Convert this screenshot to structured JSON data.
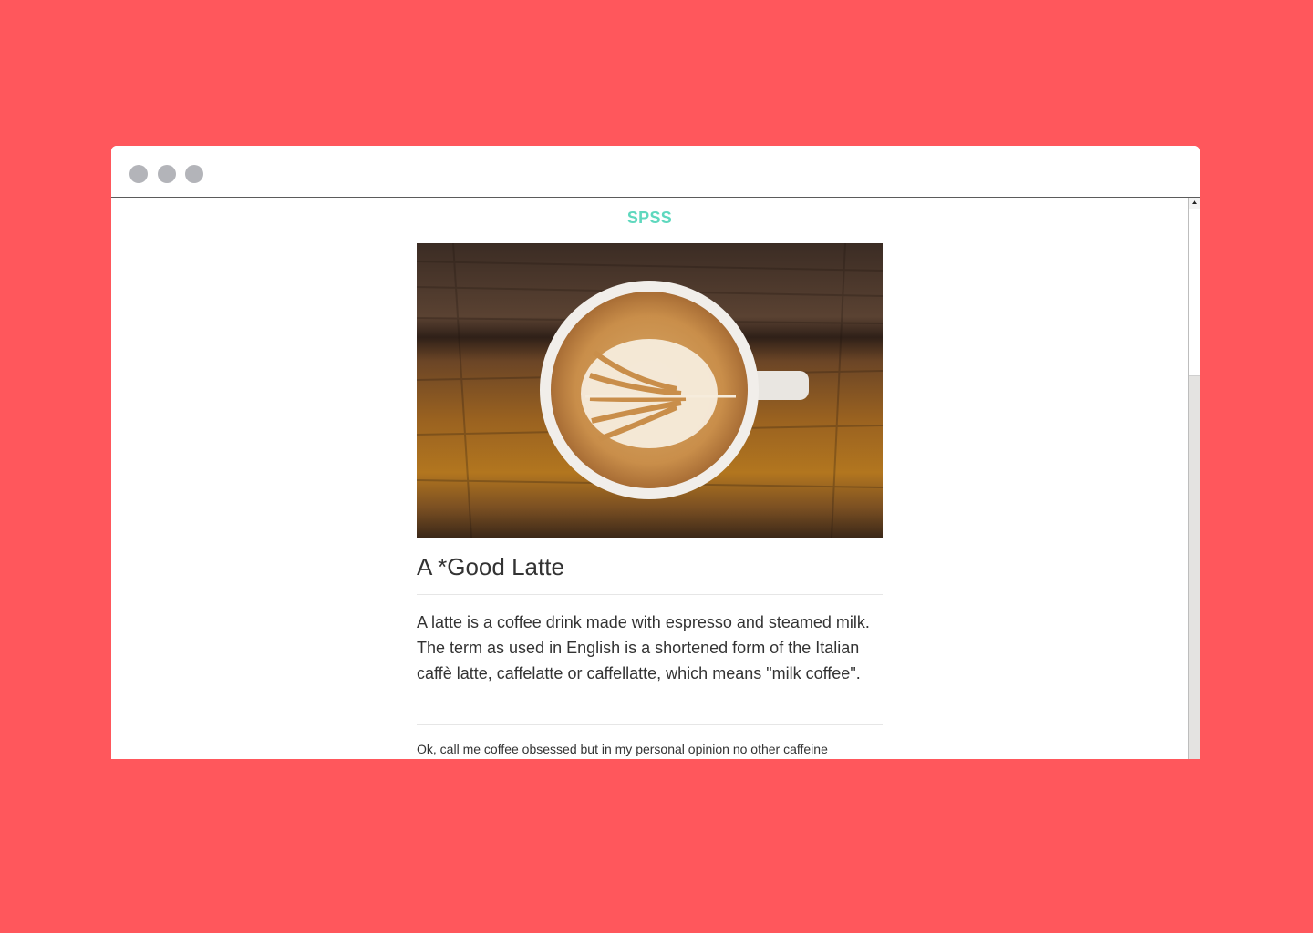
{
  "window": {
    "controls": [
      "close",
      "minimize",
      "maximize"
    ]
  },
  "page": {
    "brand": "SPSS",
    "hero_image_alt": "latte-art-coffee-cup-photo",
    "title": "A *Good Latte",
    "lead": "A latte is a coffee drink made with espresso and steamed milk. The term as used in English is a shortened form of the Italian caffè latte, caffelatte or caffellatte, which means \"milk coffee\".",
    "body": "Ok, call me coffee obsessed but in my personal opinion no other caffeine"
  },
  "colors": {
    "background": "#ff575c",
    "brand": "#5fd8be",
    "text": "#333333",
    "window_dots": "#b3b4b9"
  }
}
